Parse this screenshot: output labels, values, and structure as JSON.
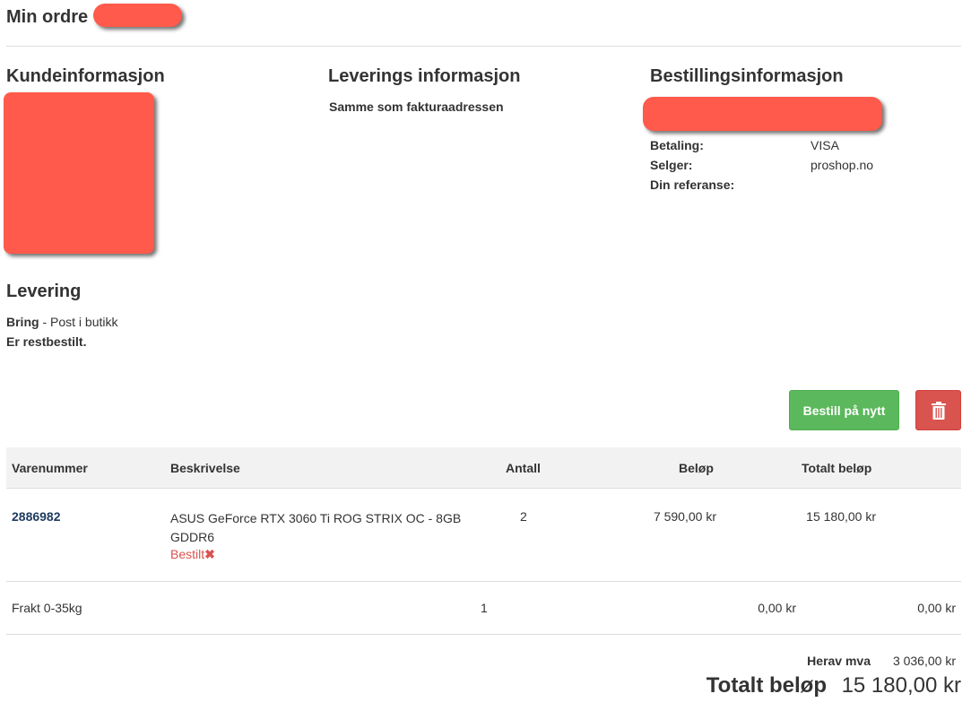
{
  "header": {
    "title": "Min ordre"
  },
  "customer": {
    "heading": "Kundeinformasjon"
  },
  "delivery_info": {
    "heading": "Leverings informasjon",
    "text": "Samme som fakturaadressen"
  },
  "order_info": {
    "heading": "Bestillingsinformasjon",
    "rows": [
      {
        "label": "Betaling:",
        "value": "VISA"
      },
      {
        "label": "Selger:",
        "value": "proshop.no"
      },
      {
        "label": "Din referanse:",
        "value": ""
      }
    ]
  },
  "shipping": {
    "heading": "Levering",
    "carrier": "Bring",
    "method": " - Post i butikk",
    "note": "Er restbestilt."
  },
  "actions": {
    "reorder_label": "Bestill på nytt",
    "delete_icon": "trash-icon"
  },
  "table": {
    "headers": [
      "Varenummer",
      "Beskrivelse",
      "Antall",
      "Beløp",
      "Totalt beløp"
    ],
    "item": {
      "sku": "2886982",
      "description": "ASUS GeForce RTX 3060 Ti ROG STRIX OC - 8GB GDDR6",
      "status": "Bestilt",
      "status_icon": "cross-icon",
      "quantity": "2",
      "price": "7 590,00 kr",
      "total": "15 180,00 kr"
    },
    "freight": {
      "description": "Frakt 0-35kg",
      "quantity": "1",
      "price": "0,00 kr",
      "total": "0,00 kr"
    }
  },
  "summary": {
    "vat_label": "Herav mva",
    "vat_value": "3 036,00 kr",
    "total_label": "Totalt beløp",
    "total_value": "15 180,00 kr"
  },
  "colors": {
    "accent_green": "#5cb85c",
    "accent_red": "#d9534f",
    "redaction": "#ff5a4b"
  }
}
